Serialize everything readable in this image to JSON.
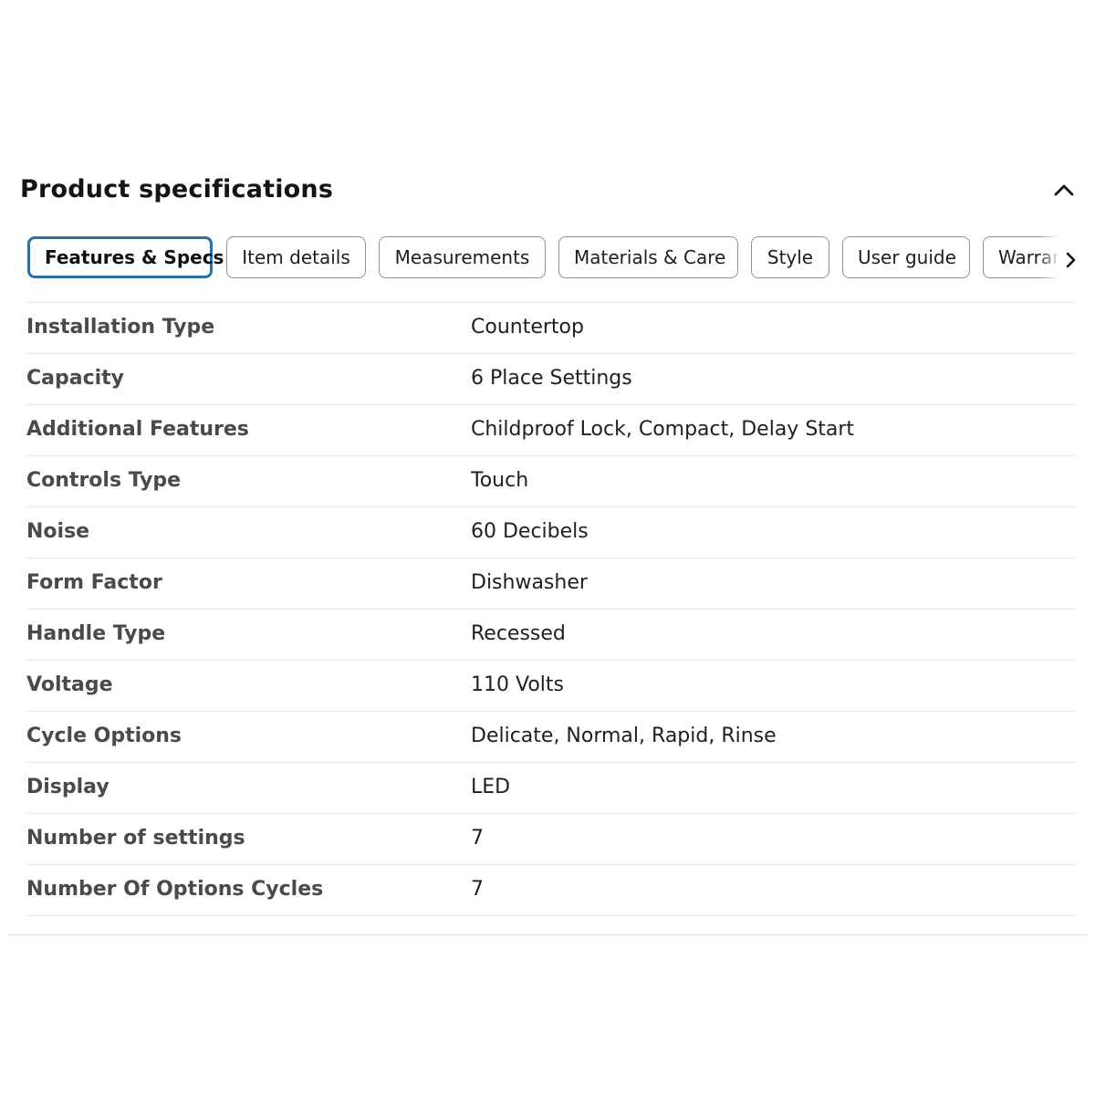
{
  "section": {
    "title": "Product specifications",
    "toggle_icon": "chevron-up-icon"
  },
  "tabs": [
    {
      "label": "Features & Specs",
      "active": true
    },
    {
      "label": "Item details",
      "active": false
    },
    {
      "label": "Measurements",
      "active": false
    },
    {
      "label": "Materials & Care",
      "active": false
    },
    {
      "label": "Style",
      "active": false
    },
    {
      "label": "User guide",
      "active": false
    },
    {
      "label": "Warranty",
      "active": false
    }
  ],
  "tabs_next_icon": "chevron-right-icon",
  "colors": {
    "active_tab_border": "#2e6fa1",
    "tab_border": "#8f8f8f",
    "row_divider": "#e2e2e2",
    "label_text": "#4a4a4a"
  },
  "specs": [
    {
      "label": "Installation Type",
      "value": "Countertop"
    },
    {
      "label": "Capacity",
      "value": "6 Place Settings"
    },
    {
      "label": "Additional Features",
      "value": "Childproof Lock, Compact, Delay Start"
    },
    {
      "label": "Controls Type",
      "value": "Touch"
    },
    {
      "label": "Noise",
      "value": "60 Decibels"
    },
    {
      "label": "Form Factor",
      "value": "Dishwasher"
    },
    {
      "label": "Handle Type",
      "value": "Recessed"
    },
    {
      "label": "Voltage",
      "value": "110 Volts"
    },
    {
      "label": "Cycle Options",
      "value": "Delicate, Normal, Rapid, Rinse"
    },
    {
      "label": "Display",
      "value": "LED"
    },
    {
      "label": "Number of settings",
      "value": "7"
    },
    {
      "label": "Number Of Options Cycles",
      "value": "7"
    }
  ]
}
